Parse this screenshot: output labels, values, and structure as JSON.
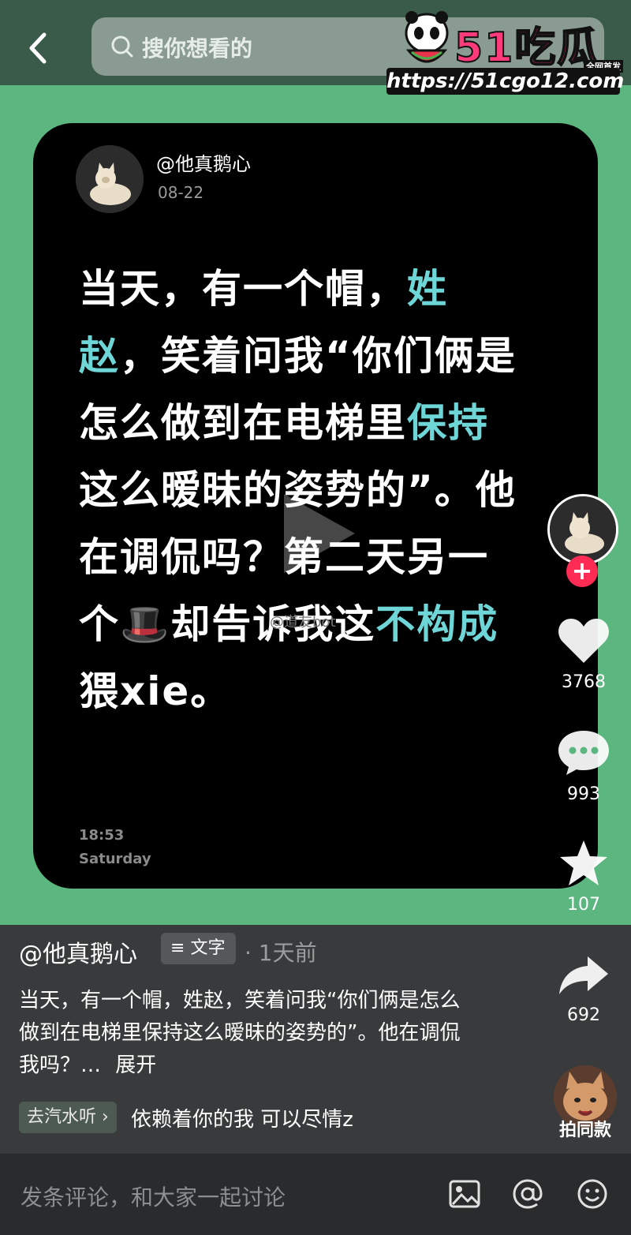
{
  "search": {
    "placeholder": "搜你想看的"
  },
  "watermark": {
    "brand": "51吃瓜",
    "tag": "全网首发",
    "url": "https://51cgo12.com"
  },
  "post": {
    "author": "@他真鹅心",
    "date": "08-22",
    "segments": [
      {
        "t": "当天，有一个帽，",
        "hl": false
      },
      {
        "t": "姓赵",
        "hl": true
      },
      {
        "t": "，笑着问我“你们俩是怎么做到在电梯里",
        "hl": false
      },
      {
        "t": "保持",
        "hl": true
      },
      {
        "t": "这么暧昧的姿势的”。他在调侃吗？第二天另一个🎩却告诉我这",
        "hl": false
      },
      {
        "t": "不构成",
        "hl": true
      },
      {
        "t": "猥xie。",
        "hl": false
      }
    ],
    "inner_watermark": "@道友bot",
    "time": "18:53",
    "day": "Saturday"
  },
  "rail": {
    "likes": "3768",
    "comments": "993",
    "favorites": "107",
    "shares": "692",
    "same_style": "拍同款"
  },
  "description": {
    "author": "@他真鹅心",
    "type_chip": "文字",
    "time": "· 1天前",
    "text": "当天，有一个帽，姓赵，笑着问我“你们俩是怎么做到在电梯里保持这么暧昧的姿势的”。他在调侃我吗？…",
    "expand": "展开",
    "music_chip": "去汽水听 ›",
    "music": "依赖着你的我 可以尽情z"
  },
  "comment": {
    "placeholder": "发条评论，和大家一起讨论"
  },
  "colors": {
    "accent": "#6fd6d8",
    "bg_green": "#5cb67f",
    "like_red": "#fe2c55"
  }
}
